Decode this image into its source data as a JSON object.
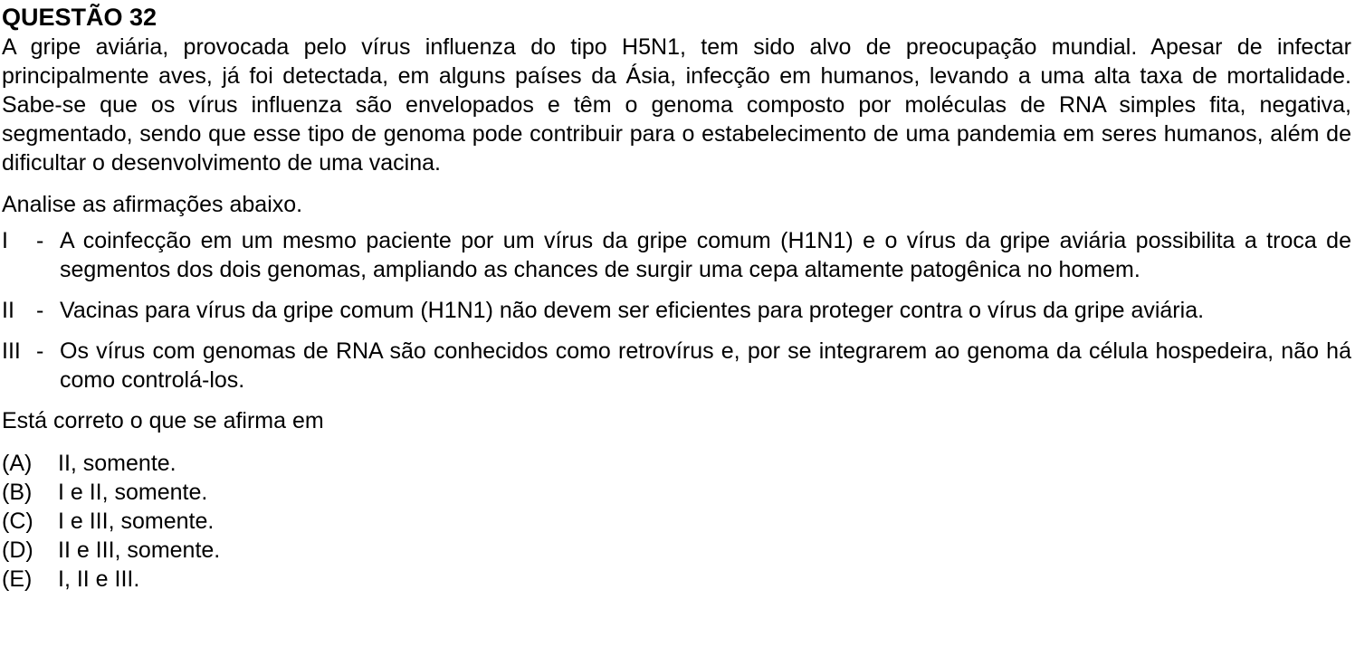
{
  "question": {
    "title": "QUESTÃO 32",
    "intro": "A gripe aviária, provocada pelo vírus influenza do tipo H5N1, tem sido alvo de preocupação mundial. Apesar de infectar principalmente aves, já foi detectada, em alguns países da Ásia, infecção em humanos, levando a uma alta taxa de mortalidade. Sabe-se que os vírus influenza são envelopados e têm o genoma composto por moléculas de RNA simples fita, negativa, segmentado, sendo que esse tipo de genoma pode contribuir para o estabelecimento de uma pandemia em seres humanos, além de dificultar o desenvolvimento de uma vacina.",
    "instruction": "Analise as afirmações abaixo.",
    "dash": "-",
    "statements": [
      {
        "numeral": "I",
        "text": "A coinfecção em um mesmo paciente por um vírus da gripe comum (H1N1) e o vírus da gripe aviária possibilita a troca de segmentos dos dois genomas, ampliando as chances de surgir uma cepa altamente patogênica no homem."
      },
      {
        "numeral": "II",
        "text": "Vacinas para vírus da gripe comum (H1N1) não devem ser eficientes para proteger contra o vírus da gripe aviária."
      },
      {
        "numeral": "III",
        "text": "Os vírus com genomas de RNA são conhecidos como retrovírus e, por se integrarem ao genoma da célula hospedeira, não há como controlá-los."
      }
    ],
    "prompt": "Está correto o que se afirma em",
    "options": [
      {
        "letter": "(A)",
        "text": "II, somente."
      },
      {
        "letter": "(B)",
        "text": "I e II, somente."
      },
      {
        "letter": "(C)",
        "text": "I e III, somente."
      },
      {
        "letter": "(D)",
        "text": "II e III, somente."
      },
      {
        "letter": "(E)",
        "text": "I, II e III."
      }
    ]
  }
}
